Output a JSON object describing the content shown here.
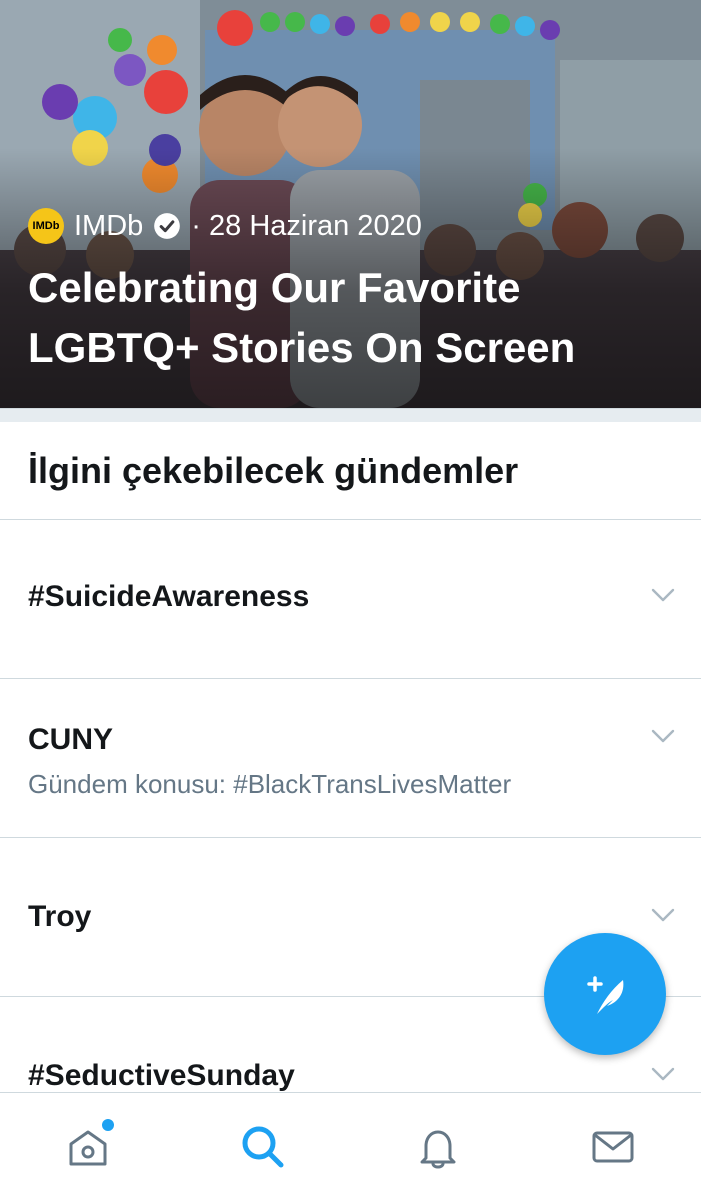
{
  "hero": {
    "source": "IMDb",
    "logo_text": "IMDb",
    "date": "· 28 Haziran 2020",
    "title_line1": "Celebrating Our Favorite",
    "title_line2": "LGBTQ+ Stories On Screen"
  },
  "section_title": "İlgini çekebilecek gündemler",
  "trends": [
    {
      "name": "#SuicideAwareness",
      "sub": ""
    },
    {
      "name": "CUNY",
      "sub": "Gündem konusu: #BlackTransLivesMatter"
    },
    {
      "name": "Troy",
      "sub": ""
    },
    {
      "name": "#SeductiveSunday",
      "sub": ""
    }
  ],
  "nav": {
    "items": [
      "home-icon",
      "search-icon",
      "notifications-icon",
      "messages-icon"
    ],
    "active": "search-icon"
  },
  "colors": {
    "accent": "#1da1f2",
    "text": "#14171a",
    "secondary": "#657786",
    "divider": "#cfd9de",
    "imdb": "#f5c518"
  }
}
